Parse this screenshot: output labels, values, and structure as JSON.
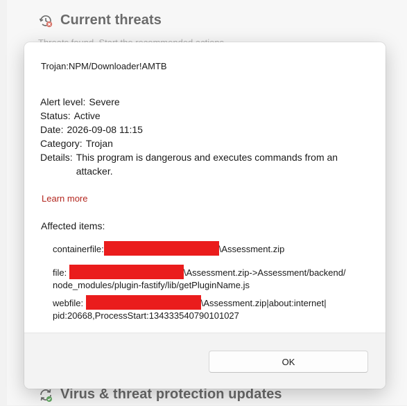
{
  "background": {
    "top_section": {
      "title": "Current threats",
      "icon": "threat-history-icon",
      "subtext": "Threats found. Start the recommended actions."
    },
    "bottom_section": {
      "title": "Virus & threat protection updates",
      "icon": "refresh-icon"
    }
  },
  "dialog": {
    "threat_name": "Trojan:NPM/Downloader!AMTB",
    "details": [
      {
        "key": "Alert level:",
        "value": "Severe"
      },
      {
        "key": "Status:",
        "value": "Active"
      },
      {
        "key": "Date:",
        "value": "2026-09-08 11:15"
      },
      {
        "key": "Category:",
        "value": "Trojan"
      },
      {
        "key": "Details:",
        "value": "This program is dangerous and executes commands from an attacker."
      }
    ],
    "learn_more": "Learn more",
    "affected_title": "Affected items:",
    "affected_items": [
      {
        "label": "containerfile:",
        "suffix": "\\Assessment.zip"
      },
      {
        "label": "file:",
        "suffix": "\\Assessment.zip->Assessment/backend/",
        "line2": "node_modules/plugin-fastify/lib/getPluginName.js"
      },
      {
        "label": "webfile:",
        "suffix": "\\Assessment.zip|about:internet|",
        "line2": "pid:20668,ProcessStart:134333540790101027"
      }
    ],
    "ok_label": "OK"
  },
  "colors": {
    "redaction": "#ea1c1c",
    "link": "#b3261e"
  }
}
